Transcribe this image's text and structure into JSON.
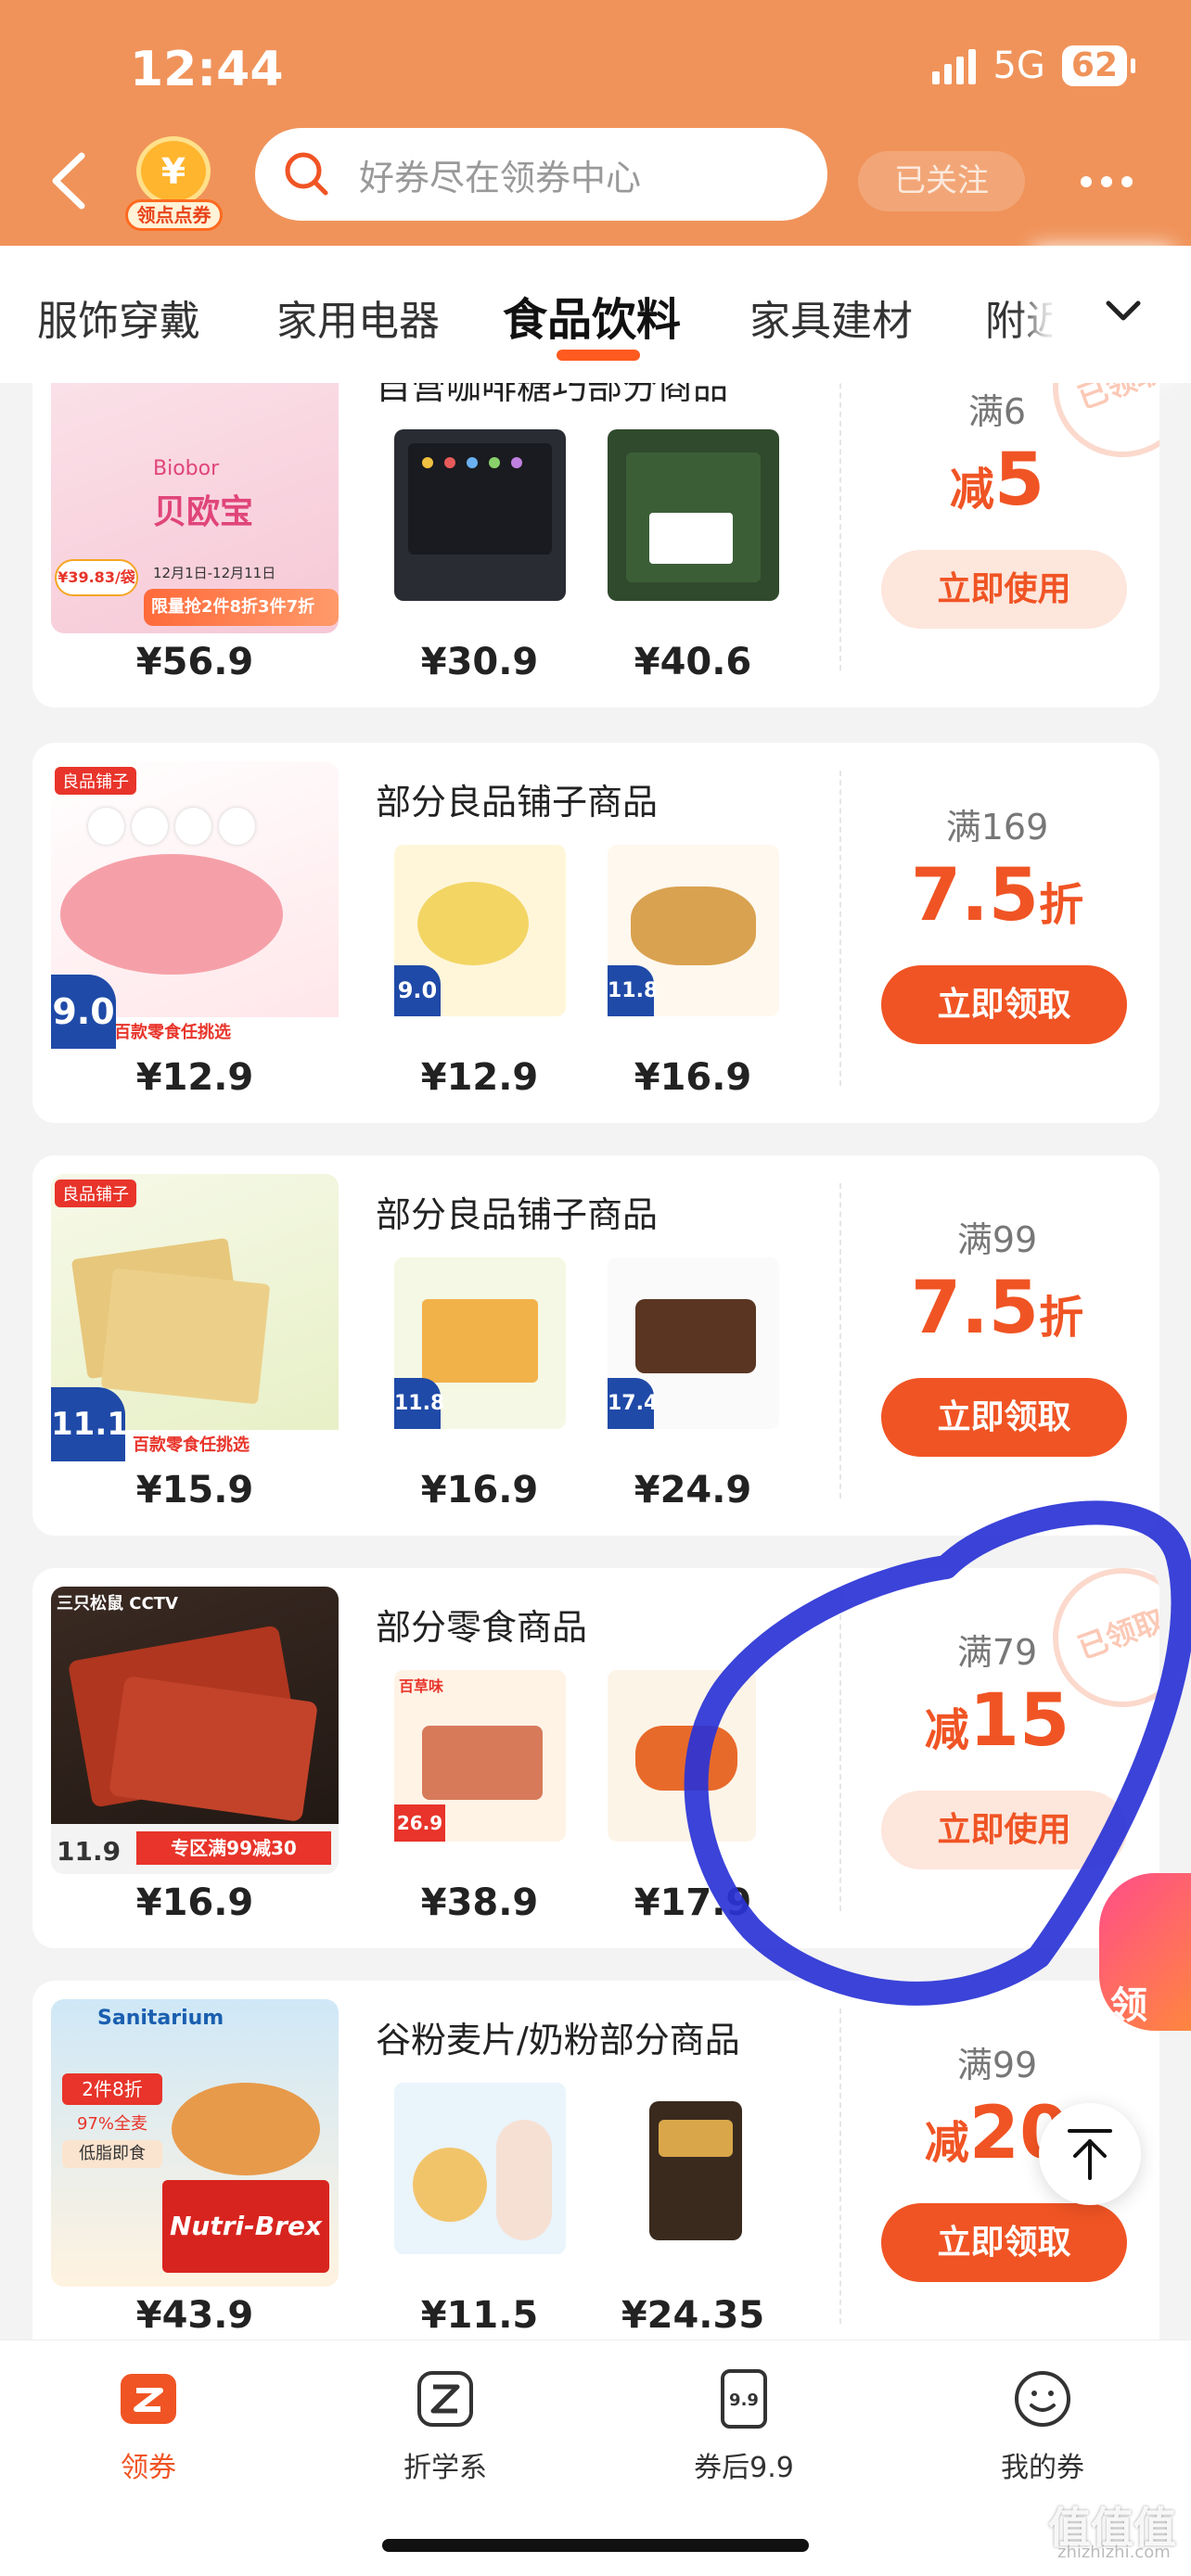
{
  "status_bar": {
    "time": "12:44",
    "network": "5G",
    "battery": "62"
  },
  "header": {
    "logo_text": "领点点券",
    "logo_symbol": "¥",
    "search_placeholder": "好券尽在领券中心",
    "follow_label": "已关注"
  },
  "tabs": [
    {
      "label": "服饰穿戴"
    },
    {
      "label": "家用电器"
    },
    {
      "label": "食品饮料",
      "active": true
    },
    {
      "label": "家具建材"
    },
    {
      "label": "附近"
    }
  ],
  "cards": [
    {
      "title": "自营咖啡糖巧部分商品",
      "prices": [
        "¥56.9",
        "¥30.9",
        "¥40.6"
      ],
      "condition": "满6",
      "discount_prefix": "减",
      "discount_value": "5",
      "discount_suffix": "",
      "action": "立即使用",
      "stamp": "已领取",
      "image_texts": {
        "brand": "Biobor",
        "name": "贝欧宝",
        "label": "限量抢2件8折3件7折",
        "price_tag": "¥39.83/袋",
        "date": "12月1日-12月11日"
      }
    },
    {
      "title": "部分良品铺子商品",
      "prices": [
        "¥12.9",
        "¥12.9",
        "¥16.9"
      ],
      "condition": "满169",
      "discount_prefix": "",
      "discount_value": "7.5",
      "discount_suffix": "折",
      "action": "立即领取",
      "image_texts": {
        "brand": "良品铺子",
        "label": "百款零食任挑选",
        "num": "9.0",
        "thumb_num_1": "9.0",
        "thumb_num_2": "11.8"
      }
    },
    {
      "title": "部分良品铺子商品",
      "prices": [
        "¥15.9",
        "¥16.9",
        "¥24.9"
      ],
      "condition": "满99",
      "discount_prefix": "",
      "discount_value": "7.5",
      "discount_suffix": "折",
      "action": "立即领取",
      "image_texts": {
        "brand": "良品铺子",
        "label": "百款零食任挑选",
        "num": "11.1",
        "thumb_num_1": "11.8",
        "thumb_num_2": "17.4"
      }
    },
    {
      "title": "部分零食商品",
      "prices": [
        "¥16.9",
        "¥38.9",
        "¥17.9"
      ],
      "condition": "满79",
      "discount_prefix": "减",
      "discount_value": "15",
      "discount_suffix": "",
      "action": "立即使用",
      "stamp": "已领取",
      "image_texts": {
        "brand": "三只松鼠 CCTV",
        "label": "专区满99减30",
        "num": "11.9",
        "thumb_brand": "百草味",
        "thumb_num": "26.9"
      }
    },
    {
      "title": "谷粉麦片/奶粉部分商品",
      "prices": [
        "¥43.9",
        "¥11.5",
        "¥24.35"
      ],
      "condition": "满99",
      "discount_prefix": "减",
      "discount_value": "20",
      "discount_suffix": "",
      "action": "立即领取",
      "image_texts": {
        "brand": "Sanitarium",
        "tag1": "2件8折",
        "tag2": "97%全麦",
        "tag3": "低脂即食",
        "product": "Nutri-Brex"
      }
    }
  ],
  "bottom_nav": [
    {
      "label": "领券",
      "icon": "coupon-icon",
      "active": true
    },
    {
      "label": "折学系",
      "icon": "z-icon"
    },
    {
      "label": "券后9.9",
      "icon": "price-tag-icon",
      "icon_text": "9.9"
    },
    {
      "label": "我的券",
      "icon": "smile-icon"
    }
  ],
  "floating": {
    "promo_text": "领"
  },
  "watermark": {
    "text": "值值值",
    "url": "zhizhizhi.com"
  },
  "colors": {
    "brand_orange": "#f0935a",
    "accent_red": "#f05424",
    "annotation_blue": "#2a33d6"
  }
}
